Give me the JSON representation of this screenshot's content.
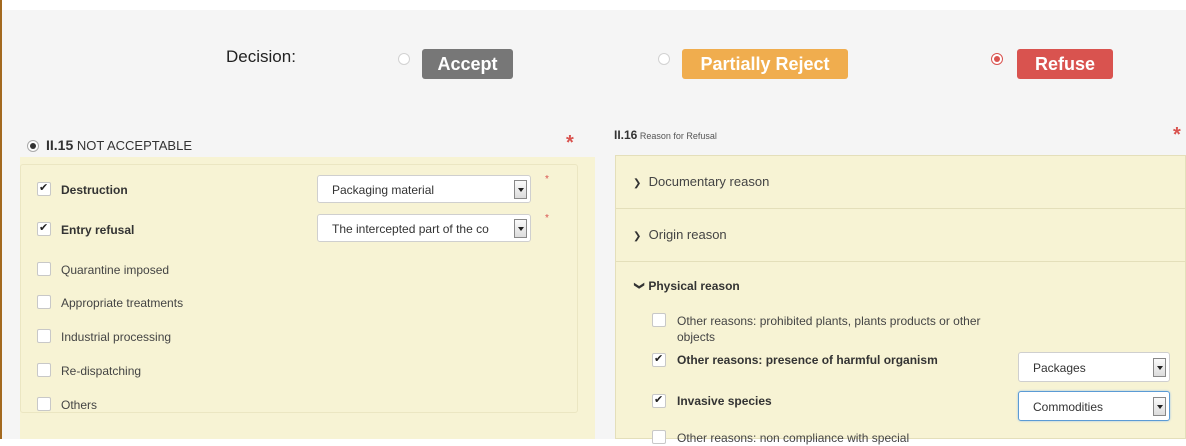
{
  "decision": {
    "label": "Decision:",
    "options": [
      {
        "label": "Accept",
        "selected": false,
        "color": "#777777"
      },
      {
        "label": "Partially Reject",
        "selected": false,
        "color": "#f0ad4e"
      },
      {
        "label": "Refuse",
        "selected": true,
        "color": "#d9534f"
      }
    ]
  },
  "left_section": {
    "code": "II.15",
    "title": "NOT ACCEPTABLE",
    "required_marker": "*",
    "items": [
      {
        "label": "Destruction",
        "checked": true,
        "select_value": "Packaging material",
        "required": "*"
      },
      {
        "label": "Entry refusal",
        "checked": true,
        "select_value": "The intercepted part of the co",
        "required": "*"
      },
      {
        "label": "Quarantine imposed",
        "checked": false
      },
      {
        "label": "Appropriate treatments",
        "checked": false
      },
      {
        "label": "Industrial processing",
        "checked": false
      },
      {
        "label": "Re-dispatching",
        "checked": false
      },
      {
        "label": "Others",
        "checked": false
      }
    ]
  },
  "right_section": {
    "code": "II.16",
    "title": "Reason for Refusal",
    "required_marker": "*",
    "accordion": [
      {
        "label": "Documentary reason",
        "expanded": false
      },
      {
        "label": "Origin reason",
        "expanded": false
      },
      {
        "label": "Physical reason",
        "expanded": true
      }
    ],
    "physical_reasons": [
      {
        "label": "Other reasons: prohibited plants, plants products or other objects",
        "checked": false
      },
      {
        "label": "Other reasons: presence of harmful organism",
        "checked": true,
        "select_value": "Packages"
      },
      {
        "label": "Invasive species",
        "checked": true,
        "select_value": "Commodities"
      },
      {
        "label": "Other reasons: non compliance with special",
        "checked": false
      }
    ]
  }
}
